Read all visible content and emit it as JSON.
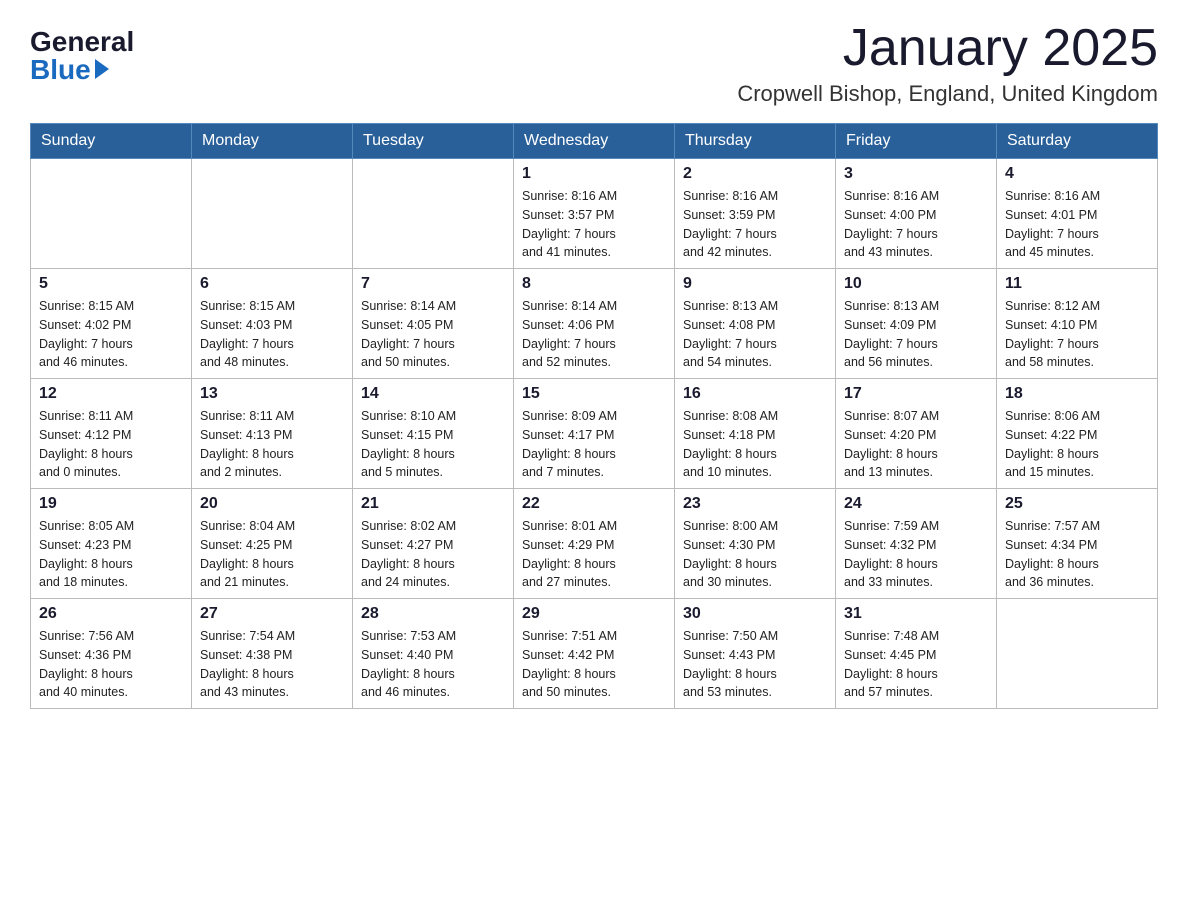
{
  "header": {
    "logo_general": "General",
    "logo_blue": "Blue",
    "month_title": "January 2025",
    "location": "Cropwell Bishop, England, United Kingdom"
  },
  "weekdays": [
    "Sunday",
    "Monday",
    "Tuesday",
    "Wednesday",
    "Thursday",
    "Friday",
    "Saturday"
  ],
  "weeks": [
    [
      {
        "day": "",
        "info": ""
      },
      {
        "day": "",
        "info": ""
      },
      {
        "day": "",
        "info": ""
      },
      {
        "day": "1",
        "info": "Sunrise: 8:16 AM\nSunset: 3:57 PM\nDaylight: 7 hours\nand 41 minutes."
      },
      {
        "day": "2",
        "info": "Sunrise: 8:16 AM\nSunset: 3:59 PM\nDaylight: 7 hours\nand 42 minutes."
      },
      {
        "day": "3",
        "info": "Sunrise: 8:16 AM\nSunset: 4:00 PM\nDaylight: 7 hours\nand 43 minutes."
      },
      {
        "day": "4",
        "info": "Sunrise: 8:16 AM\nSunset: 4:01 PM\nDaylight: 7 hours\nand 45 minutes."
      }
    ],
    [
      {
        "day": "5",
        "info": "Sunrise: 8:15 AM\nSunset: 4:02 PM\nDaylight: 7 hours\nand 46 minutes."
      },
      {
        "day": "6",
        "info": "Sunrise: 8:15 AM\nSunset: 4:03 PM\nDaylight: 7 hours\nand 48 minutes."
      },
      {
        "day": "7",
        "info": "Sunrise: 8:14 AM\nSunset: 4:05 PM\nDaylight: 7 hours\nand 50 minutes."
      },
      {
        "day": "8",
        "info": "Sunrise: 8:14 AM\nSunset: 4:06 PM\nDaylight: 7 hours\nand 52 minutes."
      },
      {
        "day": "9",
        "info": "Sunrise: 8:13 AM\nSunset: 4:08 PM\nDaylight: 7 hours\nand 54 minutes."
      },
      {
        "day": "10",
        "info": "Sunrise: 8:13 AM\nSunset: 4:09 PM\nDaylight: 7 hours\nand 56 minutes."
      },
      {
        "day": "11",
        "info": "Sunrise: 8:12 AM\nSunset: 4:10 PM\nDaylight: 7 hours\nand 58 minutes."
      }
    ],
    [
      {
        "day": "12",
        "info": "Sunrise: 8:11 AM\nSunset: 4:12 PM\nDaylight: 8 hours\nand 0 minutes."
      },
      {
        "day": "13",
        "info": "Sunrise: 8:11 AM\nSunset: 4:13 PM\nDaylight: 8 hours\nand 2 minutes."
      },
      {
        "day": "14",
        "info": "Sunrise: 8:10 AM\nSunset: 4:15 PM\nDaylight: 8 hours\nand 5 minutes."
      },
      {
        "day": "15",
        "info": "Sunrise: 8:09 AM\nSunset: 4:17 PM\nDaylight: 8 hours\nand 7 minutes."
      },
      {
        "day": "16",
        "info": "Sunrise: 8:08 AM\nSunset: 4:18 PM\nDaylight: 8 hours\nand 10 minutes."
      },
      {
        "day": "17",
        "info": "Sunrise: 8:07 AM\nSunset: 4:20 PM\nDaylight: 8 hours\nand 13 minutes."
      },
      {
        "day": "18",
        "info": "Sunrise: 8:06 AM\nSunset: 4:22 PM\nDaylight: 8 hours\nand 15 minutes."
      }
    ],
    [
      {
        "day": "19",
        "info": "Sunrise: 8:05 AM\nSunset: 4:23 PM\nDaylight: 8 hours\nand 18 minutes."
      },
      {
        "day": "20",
        "info": "Sunrise: 8:04 AM\nSunset: 4:25 PM\nDaylight: 8 hours\nand 21 minutes."
      },
      {
        "day": "21",
        "info": "Sunrise: 8:02 AM\nSunset: 4:27 PM\nDaylight: 8 hours\nand 24 minutes."
      },
      {
        "day": "22",
        "info": "Sunrise: 8:01 AM\nSunset: 4:29 PM\nDaylight: 8 hours\nand 27 minutes."
      },
      {
        "day": "23",
        "info": "Sunrise: 8:00 AM\nSunset: 4:30 PM\nDaylight: 8 hours\nand 30 minutes."
      },
      {
        "day": "24",
        "info": "Sunrise: 7:59 AM\nSunset: 4:32 PM\nDaylight: 8 hours\nand 33 minutes."
      },
      {
        "day": "25",
        "info": "Sunrise: 7:57 AM\nSunset: 4:34 PM\nDaylight: 8 hours\nand 36 minutes."
      }
    ],
    [
      {
        "day": "26",
        "info": "Sunrise: 7:56 AM\nSunset: 4:36 PM\nDaylight: 8 hours\nand 40 minutes."
      },
      {
        "day": "27",
        "info": "Sunrise: 7:54 AM\nSunset: 4:38 PM\nDaylight: 8 hours\nand 43 minutes."
      },
      {
        "day": "28",
        "info": "Sunrise: 7:53 AM\nSunset: 4:40 PM\nDaylight: 8 hours\nand 46 minutes."
      },
      {
        "day": "29",
        "info": "Sunrise: 7:51 AM\nSunset: 4:42 PM\nDaylight: 8 hours\nand 50 minutes."
      },
      {
        "day": "30",
        "info": "Sunrise: 7:50 AM\nSunset: 4:43 PM\nDaylight: 8 hours\nand 53 minutes."
      },
      {
        "day": "31",
        "info": "Sunrise: 7:48 AM\nSunset: 4:45 PM\nDaylight: 8 hours\nand 57 minutes."
      },
      {
        "day": "",
        "info": ""
      }
    ]
  ]
}
